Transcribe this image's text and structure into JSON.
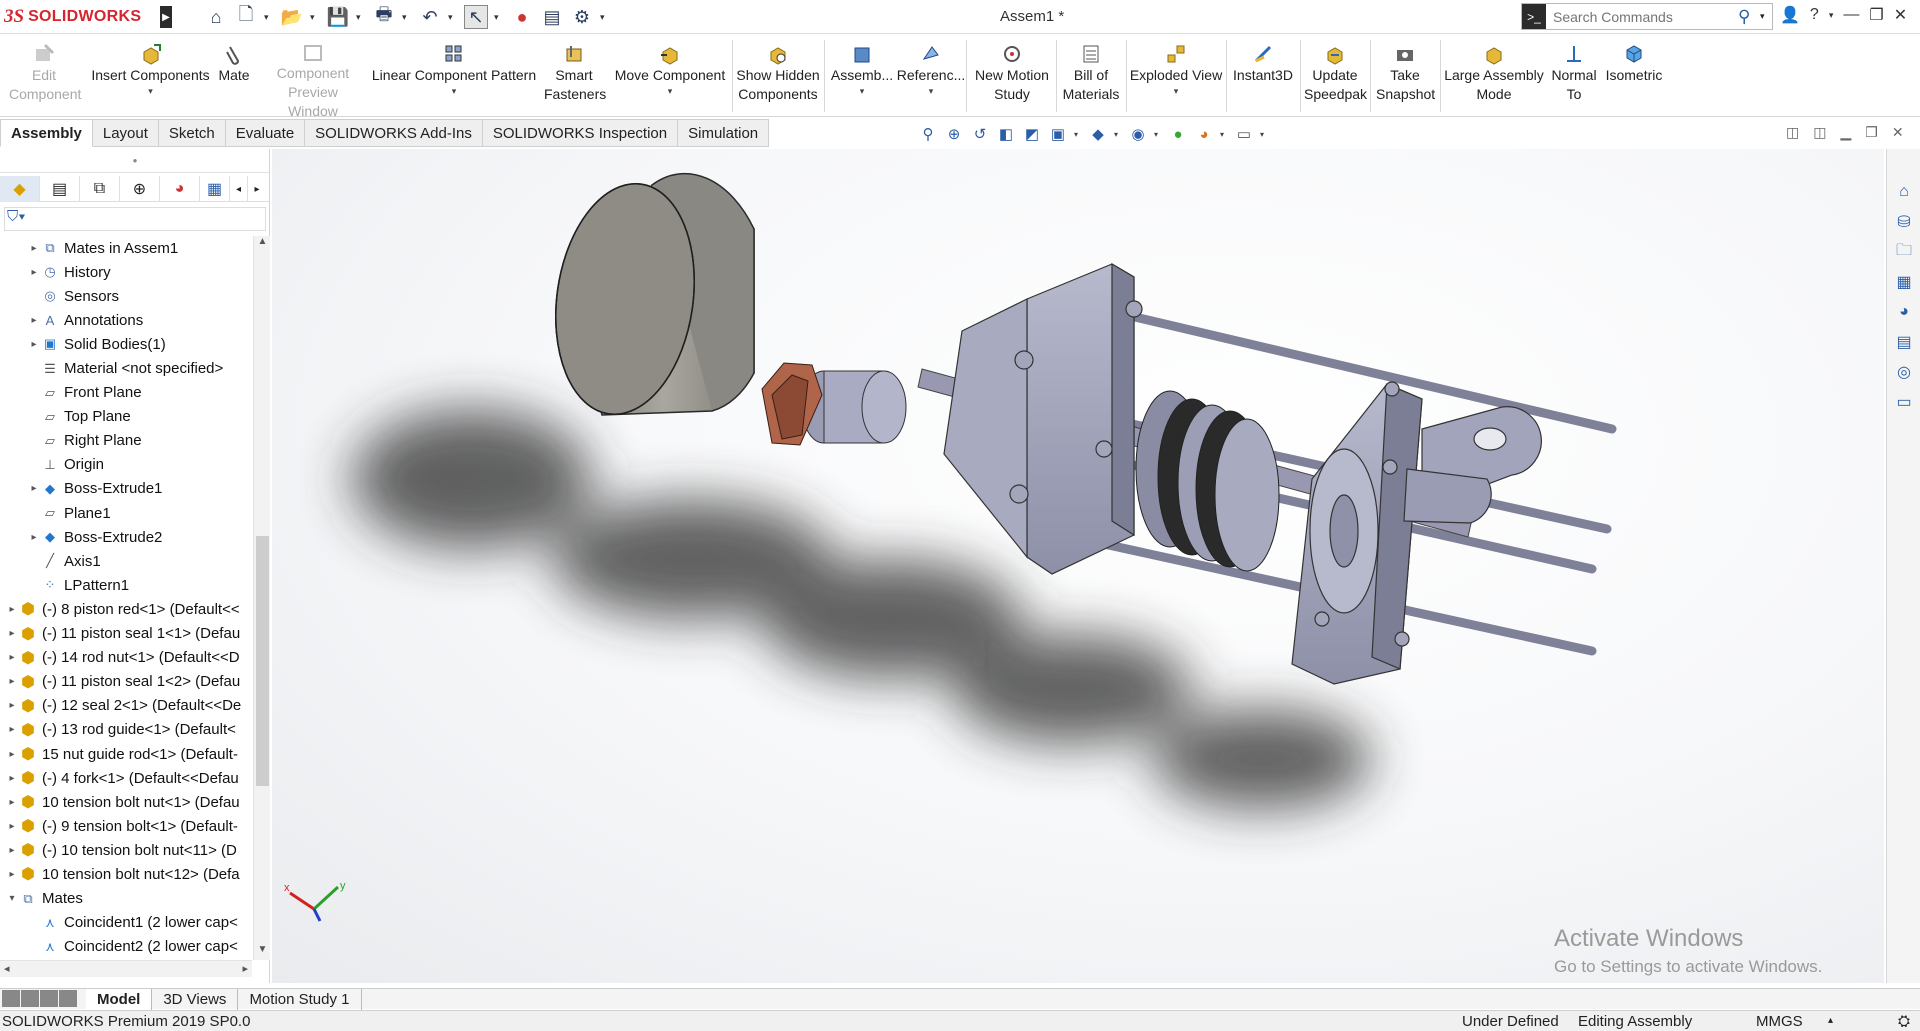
{
  "app": {
    "logo_ds": "3S",
    "logo_name": "SOLIDWORKS",
    "document_title": "Assem1 *"
  },
  "search": {
    "placeholder": "Search Commands"
  },
  "quick_access": [
    "home-icon",
    "new-document-icon",
    "open-icon",
    "save-icon",
    "print-icon",
    "undo-icon",
    "select-icon",
    "rebuild-icon",
    "file-properties-icon",
    "options-icon"
  ],
  "ribbon": {
    "edit_component": "Edit Component",
    "insert_components": "Insert Components",
    "mate": "Mate",
    "component_preview": "Component Preview Window",
    "linear_pattern": "Linear Component Pattern",
    "smart_fasteners": "Smart Fasteners",
    "move_component": "Move Component",
    "show_hidden": "Show Hidden Components",
    "assembly_features": "Assemb...",
    "reference_geometry": "Referenc...",
    "new_motion_study": "New Motion Study",
    "bill_of_materials": "Bill of Materials",
    "exploded_view": "Exploded View",
    "instant3d": "Instant3D",
    "update_speedpak": "Update Speedpak",
    "take_snapshot": "Take Snapshot",
    "large_assembly": "Large Assembly Mode",
    "normal_to": "Normal To",
    "isometric": "Isometric"
  },
  "tabs": [
    "Assembly",
    "Layout",
    "Sketch",
    "Evaluate",
    "SOLIDWORKS Add-Ins",
    "SOLIDWORKS Inspection",
    "Simulation"
  ],
  "tree": [
    {
      "label": "Mates in Assem1",
      "indent": 1,
      "expander": "▸",
      "icon": "mates-folder"
    },
    {
      "label": "History",
      "indent": 1,
      "expander": "▸",
      "icon": "history"
    },
    {
      "label": "Sensors",
      "indent": 1,
      "expander": "",
      "icon": "sensors"
    },
    {
      "label": "Annotations",
      "indent": 1,
      "expander": "▸",
      "icon": "annotations"
    },
    {
      "label": "Solid Bodies(1)",
      "indent": 1,
      "expander": "▸",
      "icon": "solid-bodies"
    },
    {
      "label": "Material <not specified>",
      "indent": 1,
      "expander": "",
      "icon": "material"
    },
    {
      "label": "Front Plane",
      "indent": 1,
      "expander": "",
      "icon": "plane"
    },
    {
      "label": "Top Plane",
      "indent": 1,
      "expander": "",
      "icon": "plane"
    },
    {
      "label": "Right Plane",
      "indent": 1,
      "expander": "",
      "icon": "plane"
    },
    {
      "label": "Origin",
      "indent": 1,
      "expander": "",
      "icon": "origin"
    },
    {
      "label": "Boss-Extrude1",
      "indent": 1,
      "expander": "▸",
      "icon": "extrude"
    },
    {
      "label": "Plane1",
      "indent": 1,
      "expander": "",
      "icon": "plane"
    },
    {
      "label": "Boss-Extrude2",
      "indent": 1,
      "expander": "▸",
      "icon": "extrude"
    },
    {
      "label": "Axis1",
      "indent": 1,
      "expander": "",
      "icon": "axis"
    },
    {
      "label": "LPattern1",
      "indent": 1,
      "expander": "",
      "icon": "pattern"
    },
    {
      "label": "(-) 8 piston red<1> (Default<<",
      "indent": 0,
      "expander": "▸",
      "icon": "part"
    },
    {
      "label": "(-) 11 piston seal 1<1> (Defau",
      "indent": 0,
      "expander": "▸",
      "icon": "part"
    },
    {
      "label": "(-) 14 rod nut<1> (Default<<D",
      "indent": 0,
      "expander": "▸",
      "icon": "part"
    },
    {
      "label": "(-) 11 piston seal 1<2> (Defau",
      "indent": 0,
      "expander": "▸",
      "icon": "part"
    },
    {
      "label": "(-) 12 seal 2<1> (Default<<De",
      "indent": 0,
      "expander": "▸",
      "icon": "part"
    },
    {
      "label": "(-) 13 rod guide<1> (Default<",
      "indent": 0,
      "expander": "▸",
      "icon": "part"
    },
    {
      "label": "15 nut guide rod<1> (Default-",
      "indent": 0,
      "expander": "▸",
      "icon": "part"
    },
    {
      "label": "(-) 4 fork<1> (Default<<Defau",
      "indent": 0,
      "expander": "▸",
      "icon": "part"
    },
    {
      "label": "10 tension bolt nut<1> (Defau",
      "indent": 0,
      "expander": "▸",
      "icon": "part"
    },
    {
      "label": "(-) 9 tension bolt<1> (Default-",
      "indent": 0,
      "expander": "▸",
      "icon": "part"
    },
    {
      "label": "(-) 10 tension bolt nut<11> (D",
      "indent": 0,
      "expander": "▸",
      "icon": "part"
    },
    {
      "label": "10 tension bolt nut<12> (Defa",
      "indent": 0,
      "expander": "▸",
      "icon": "part"
    },
    {
      "label": "Mates",
      "indent": 0,
      "expander": "▾",
      "icon": "mates-folder"
    },
    {
      "label": "Coincident1 (2 lower cap<",
      "indent": 1,
      "expander": "",
      "icon": "coincident"
    },
    {
      "label": "Coincident2 (2 lower cap<",
      "indent": 1,
      "expander": "",
      "icon": "coincident"
    }
  ],
  "watermark": {
    "line1": "Activate Windows",
    "line2": "Go to Settings to activate Windows."
  },
  "triad": {
    "x": "x",
    "y": "y"
  },
  "bottom_tabs": [
    "Model",
    "3D Views",
    "Motion Study 1"
  ],
  "status": {
    "product": "SOLIDWORKS Premium 2019 SP0.0",
    "definition": "Under Defined",
    "mode": "Editing Assembly",
    "units": "MMGS"
  },
  "colors": {
    "brand_red": "#d6252f",
    "part_metal": "#9ea0b8",
    "cylinder_head": "#8f8d86",
    "rod_nut": "#b0644a"
  }
}
